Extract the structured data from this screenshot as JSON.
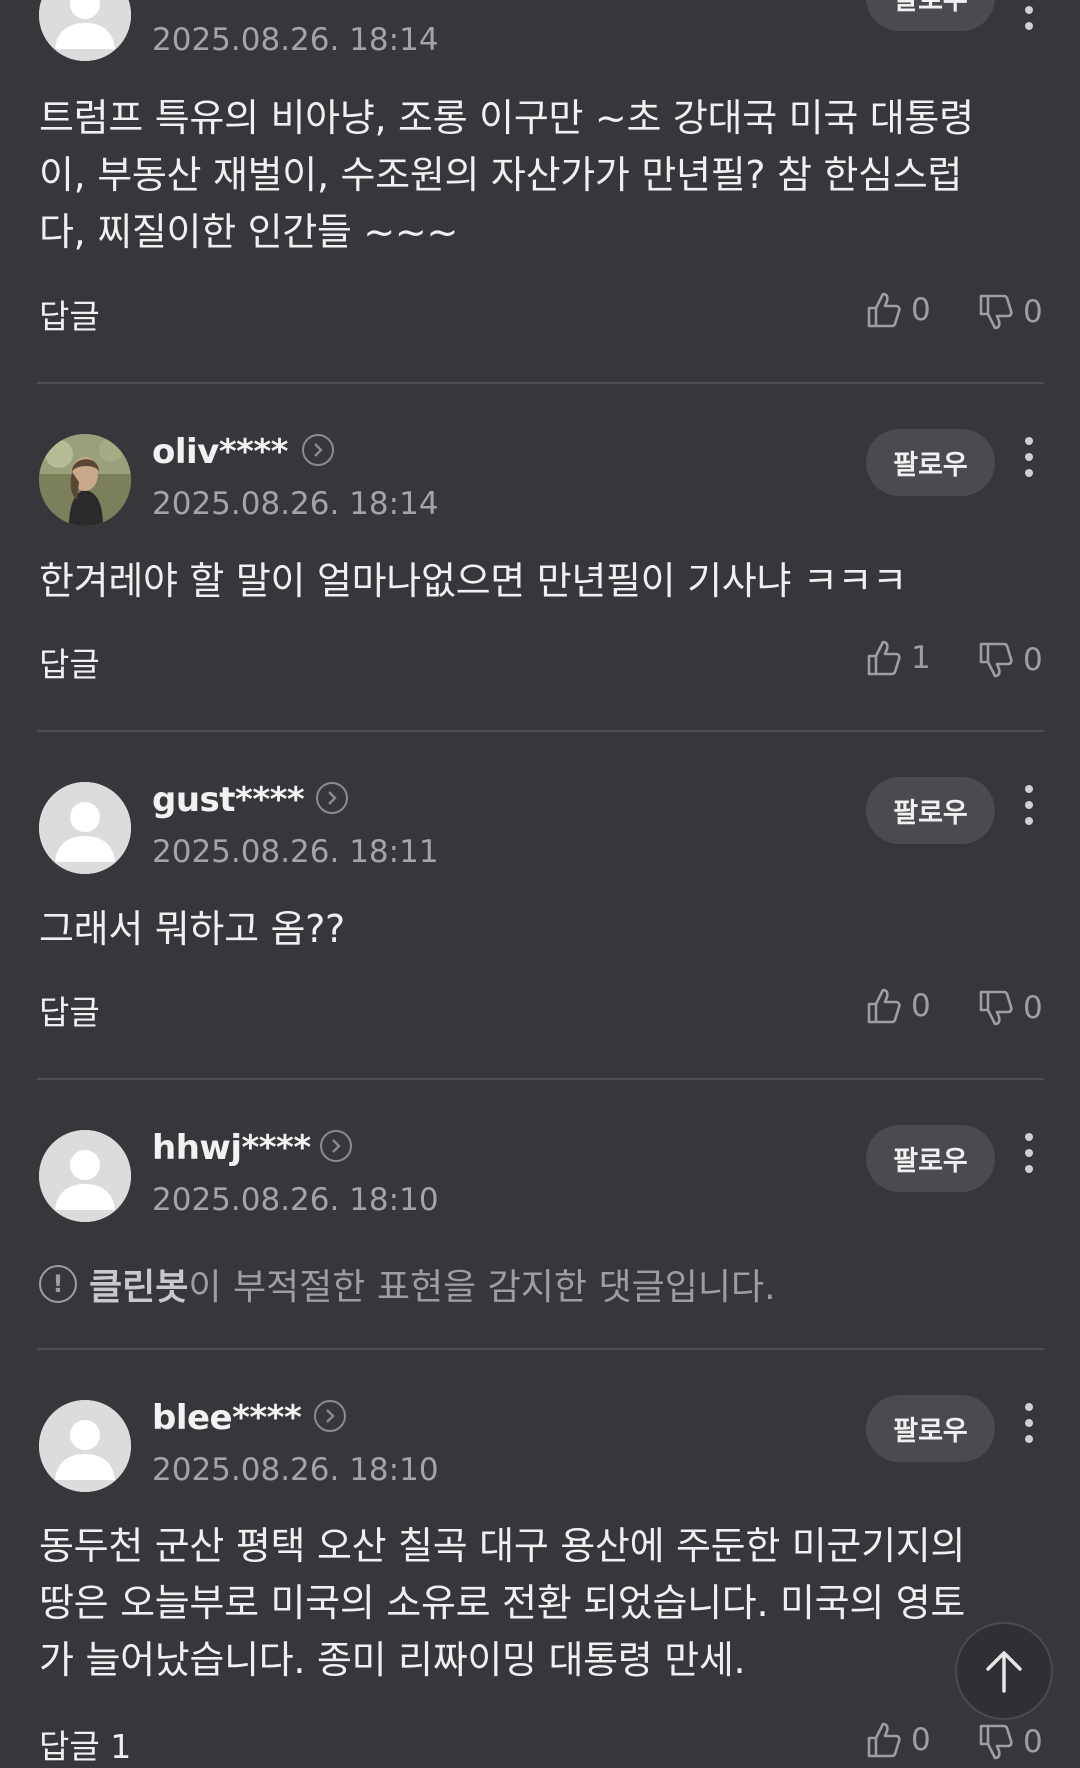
{
  "comments": [
    {
      "username": "",
      "date": "2025.08.26. 18:14",
      "follow_label": "팔로우",
      "body": "트럼프 특유의 비아냥, 조롱 이구만 ~초 강대국 미국 대통령이, 부동산 재벌이, 수조원의 자산가가 만년필? 참 한심스럽다, 찌질이한 인간들 ~~~",
      "reply_label": "답글",
      "likes": "0",
      "dislikes": "0",
      "avatar": "default-avatar"
    },
    {
      "username": "oliv****",
      "date": "2025.08.26. 18:14",
      "follow_label": "팔로우",
      "body": "한겨레야 할 말이 얼마나없으면 만년필이 기사냐 ㅋㅋㅋ",
      "reply_label": "답글",
      "likes": "1",
      "dislikes": "0",
      "avatar": "photo-avatar"
    },
    {
      "username": "gust****",
      "date": "2025.08.26. 18:11",
      "follow_label": "팔로우",
      "body": "그래서 뭐하고 옴??",
      "reply_label": "답글",
      "likes": "0",
      "dislikes": "0",
      "avatar": "default-avatar"
    },
    {
      "username": "hhwj****",
      "date": "2025.08.26. 18:10",
      "follow_label": "팔로우",
      "notice_bot": "클린봇",
      "notice_text": "이 부적절한 표현을 감지한 댓글입니다.",
      "avatar": "default-avatar"
    },
    {
      "username": "blee****",
      "date": "2025.08.26. 18:10",
      "follow_label": "팔로우",
      "body": "동두천 군산 평택 오산 칠곡 대구 용산에 주둔한 미군기지의 땅은 오늘부로 미국의 소유로 전환 되었습니다. 미국의 영토가 늘어났습니다. 종미 리짜이밍 대통령 만세.",
      "reply_label": "답글 1",
      "likes": "0",
      "dislikes": "0",
      "avatar": "default-avatar"
    }
  ],
  "icons": {
    "like": "thumbs-up-icon",
    "dislike": "thumbs-down-icon",
    "more": "more-vertical-icon",
    "profile_link": "chevron-right-circle-icon",
    "scroll_top": "arrow-up-icon",
    "notice": "exclamation-circle-icon"
  },
  "colors": {
    "background": "#36373b",
    "divider": "#4d4e52",
    "follow_button": "#4a4b50",
    "muted_text": "#a3a4a7"
  }
}
